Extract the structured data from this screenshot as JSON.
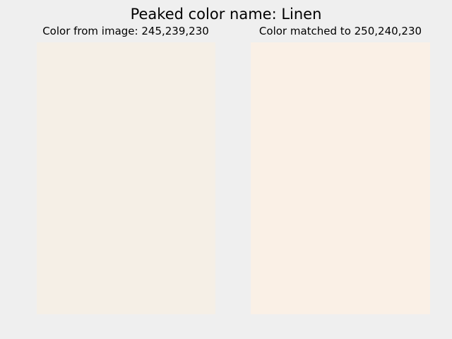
{
  "figure": {
    "title": "Peaked color name: Linen"
  },
  "panels": {
    "left": {
      "title": "Color from image: 245,239,230",
      "color": "#f5efe6"
    },
    "right": {
      "title": "Color matched to 250,240,230",
      "color": "#faf0e6"
    }
  },
  "colors": {
    "background": "#efefef"
  }
}
